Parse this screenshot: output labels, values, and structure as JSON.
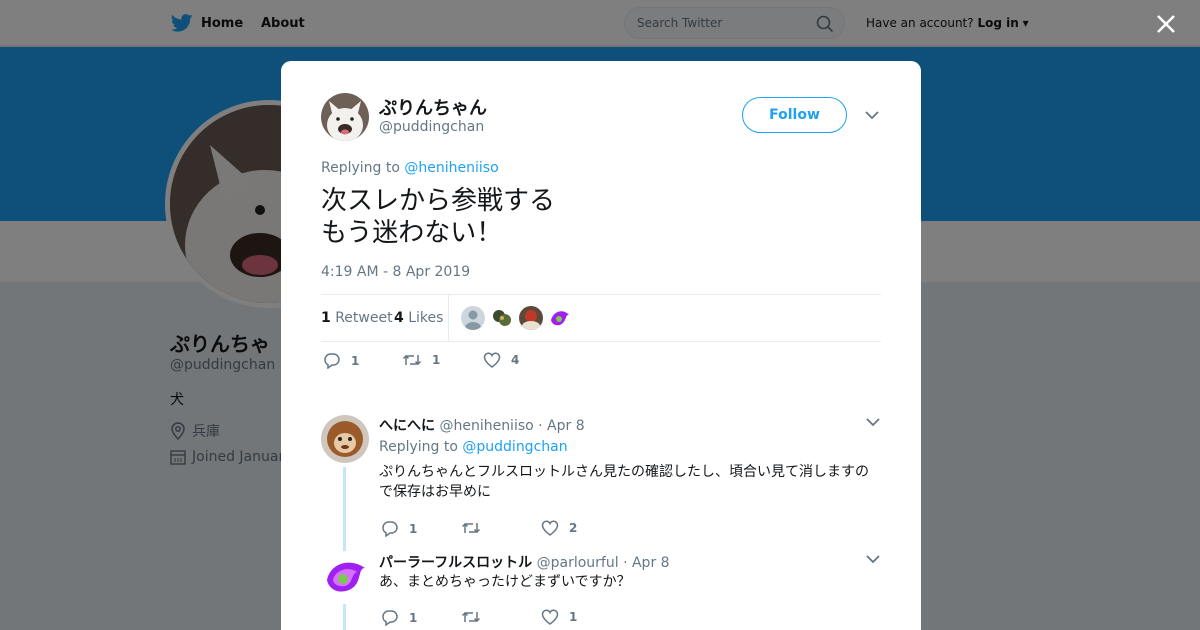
{
  "topbar": {
    "home_label": "Home",
    "about_label": "About",
    "search_placeholder": "Search Twitter",
    "account_prompt": "Have an account?",
    "login_label": "Log in"
  },
  "profile": {
    "name": "ぷりんちゃ",
    "handle": "@puddingchan",
    "bio": "犬",
    "location": "兵庫",
    "joined": "Joined Januar"
  },
  "colors": {
    "accent": "#1da1f2",
    "like": "#e0245e"
  },
  "tweet": {
    "author_name": "ぷりんちゃん",
    "author_handle": "@puddingchan",
    "follow_label": "Follow",
    "replying_prefix": "Replying to",
    "replying_to": "@heniheniiso",
    "text_line1": "次スレから参戦する",
    "text_line2": "もう迷わない！",
    "timestamp": "4:19 AM - 8 Apr 2019",
    "retweets_count": "1",
    "retweets_label": "Retweet",
    "likes_count": "4",
    "likes_label": "Likes",
    "action_reply_count": "1",
    "action_retweet_count": "1",
    "action_like_count": "4"
  },
  "replies": [
    {
      "name": "へにへに",
      "handle": "@heniheniiso",
      "date": "· Apr 8",
      "replying_prefix": "Replying to",
      "replying_to": "@puddingchan",
      "text": "ぷりんちゃんとフルスロットルさん見たの確認したし、頃合い見て消しますので保存はお早めに",
      "reply_count": "1",
      "retweet_count": "",
      "like_count": "2"
    },
    {
      "name": "パーラーフルスロットル",
      "handle": "@parlourful",
      "date": "· Apr 8",
      "text": "あ、まとめちゃったけどまずいですか？",
      "reply_count": "1",
      "retweet_count": "",
      "like_count": "1"
    }
  ]
}
